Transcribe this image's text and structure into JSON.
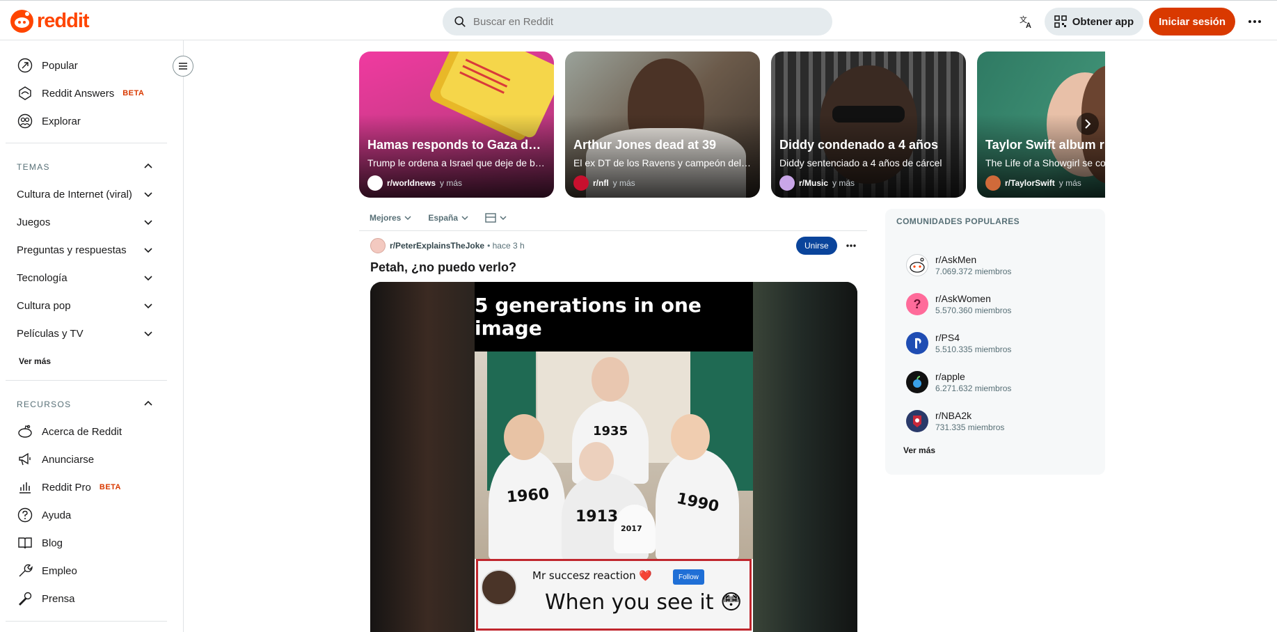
{
  "header": {
    "logo_text": "reddit",
    "search_placeholder": "Buscar en Reddit",
    "get_app_label": "Obtener app",
    "login_label": "Iniciar sesión"
  },
  "sidebar": {
    "top_items": [
      {
        "label": "Popular",
        "icon": "popular-icon"
      },
      {
        "label": "Reddit Answers",
        "badge": "BETA",
        "icon": "answers-icon"
      },
      {
        "label": "Explorar",
        "icon": "explore-icon"
      }
    ],
    "topics_title": "TEMAS",
    "topics": [
      "Cultura de Internet (viral)",
      "Juegos",
      "Preguntas y respuestas",
      "Tecnología",
      "Cultura pop",
      "Películas y TV"
    ],
    "topics_see_more": "Ver más",
    "resources_title": "RECURSOS",
    "resources": [
      {
        "label": "Acerca de Reddit",
        "icon": "reddit-icon"
      },
      {
        "label": "Anunciarse",
        "icon": "megaphone-icon"
      },
      {
        "label": "Reddit Pro",
        "badge": "BETA",
        "icon": "bar-chart-icon"
      },
      {
        "label": "Ayuda",
        "icon": "help-icon"
      },
      {
        "label": "Blog",
        "icon": "book-icon"
      },
      {
        "label": "Empleo",
        "icon": "wrench-icon"
      },
      {
        "label": "Prensa",
        "icon": "microphone-icon"
      }
    ]
  },
  "carousel": [
    {
      "title": "Hamas responds to Gaza d…",
      "subtitle": "Trump le ordena a Israel que deje de b…",
      "sub": "r/worldnews",
      "more": "y más",
      "bg": "#c93e8c"
    },
    {
      "title": "Arthur Jones dead at 39",
      "subtitle": "El ex DT de los Ravens y campeón del…",
      "sub": "r/nfl",
      "more": "y más",
      "bg": "#7a6b5d"
    },
    {
      "title": "Diddy condenado a 4 años",
      "subtitle": "Diddy sentenciado a 4 años de cárcel",
      "sub": "r/Music",
      "more": "y más",
      "bg": "#3a3a3a"
    },
    {
      "title": "Taylor Swift album r",
      "subtitle": "The Life of a Showgirl se co",
      "sub": "r/TaylorSwift",
      "more": "y más",
      "bg": "#2e6b58"
    }
  ],
  "sort": {
    "best": "Mejores",
    "region": "España"
  },
  "post": {
    "subreddit": "r/PeterExplainsTheJoke",
    "time": "• hace 3 h",
    "join_label": "Unirse",
    "title": "Petah, ¿no puedo verlo?",
    "meme": {
      "top_text": "5 generations in one image",
      "years": [
        "1935",
        "1960",
        "1913",
        "1990",
        "2017"
      ],
      "reaction_name": "Mr succesz reaction ❤️",
      "follow_label": "Follow",
      "caption": "When you see it 😳"
    }
  },
  "popular": {
    "title": "COMUNIDADES POPULARES",
    "items": [
      {
        "name": "r/AskMen",
        "members": "7.069.372 miembros",
        "color": "#ffffff"
      },
      {
        "name": "r/AskWomen",
        "members": "5.570.360 miembros",
        "color": "#ff6b9a"
      },
      {
        "name": "r/PS4",
        "members": "5.510.335 miembros",
        "color": "#1f4db3"
      },
      {
        "name": "r/apple",
        "members": "6.271.632 miembros",
        "color": "#111111"
      },
      {
        "name": "r/NBA2k",
        "members": "731.335 miembros",
        "color": "#2a3a6a"
      }
    ],
    "see_more": "Ver más"
  }
}
